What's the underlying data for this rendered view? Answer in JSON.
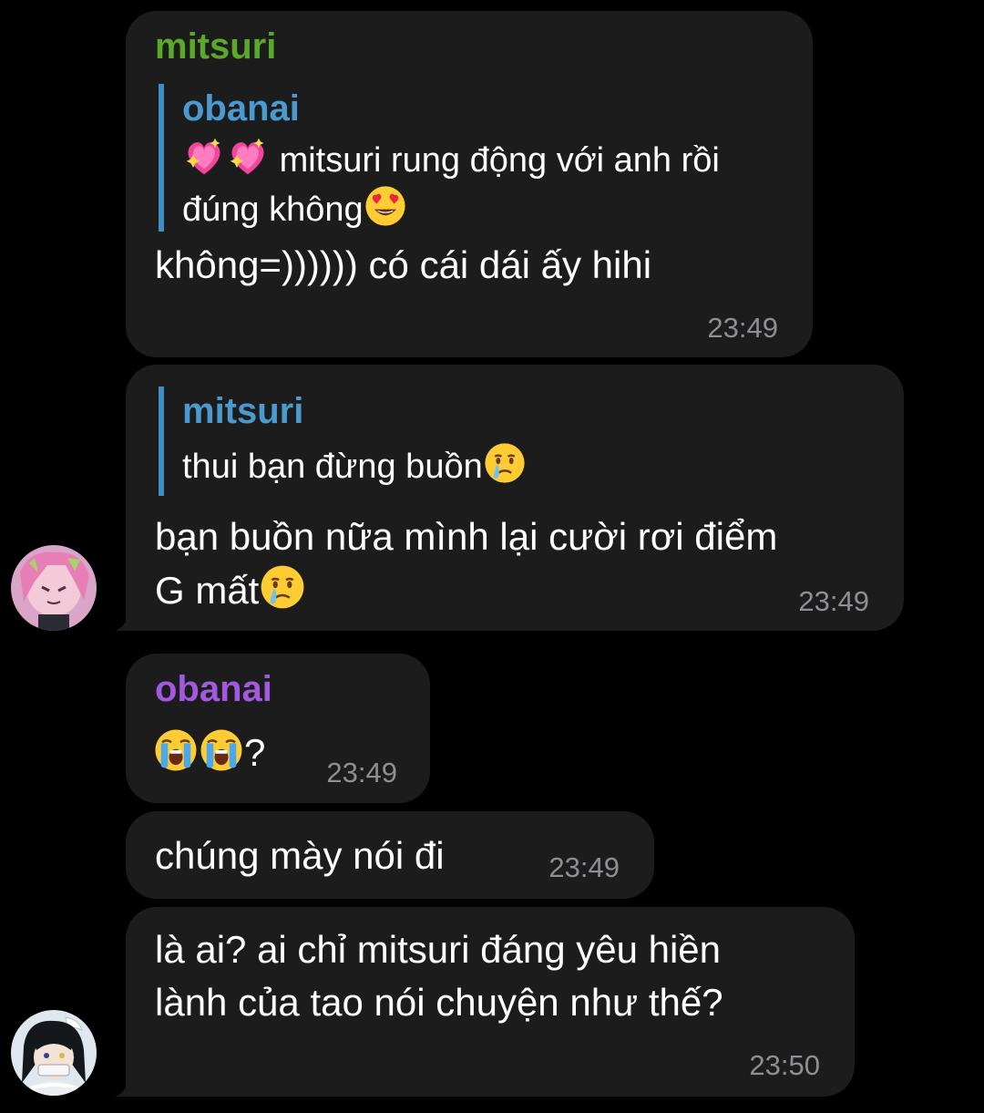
{
  "colors": {
    "background": "#000000",
    "bubble": "#1c1c1d",
    "text": "#ffffff",
    "time": "#8e8e93",
    "quote_bar": "#3e8fc4",
    "name_mitsuri": "#5aaa2a",
    "name_obanai_quote": "#4a9ad0",
    "name_obanai": "#a259e0"
  },
  "messages": [
    {
      "sender": "mitsuri",
      "reply": {
        "name": "obanai",
        "line1": "mitsuri rung động với anh rồi",
        "line1_emoji": [
          "sparkling-heart",
          "sparkling-heart"
        ],
        "line2": "đúng không",
        "line2_emoji": "heart-eyes"
      },
      "text": "không=)))))) có cái dái ấy hihi",
      "time": "23:49"
    },
    {
      "reply": {
        "name": "mitsuri",
        "text": "thui bạn đừng buồn",
        "emoji": "face-holding-back-tears"
      },
      "line1": "bạn buồn nữa mình lại cười rơi điểm",
      "line2": "G mất",
      "emoji": "face-holding-back-tears",
      "time": "23:49"
    },
    {
      "sender": "obanai",
      "emoji": [
        "loudly-crying-face",
        "loudly-crying-face"
      ],
      "text": "?",
      "time": "23:49"
    },
    {
      "text": "chúng mày nói đi",
      "time": "23:49"
    },
    {
      "line1": "là ai? ai chỉ mitsuri đáng yêu hiền",
      "line2": "lành của tao nói chuyện như thế?",
      "time": "23:50"
    }
  ],
  "avatars": {
    "mitsuri": "mitsuri-avatar",
    "obanai": "obanai-avatar"
  }
}
